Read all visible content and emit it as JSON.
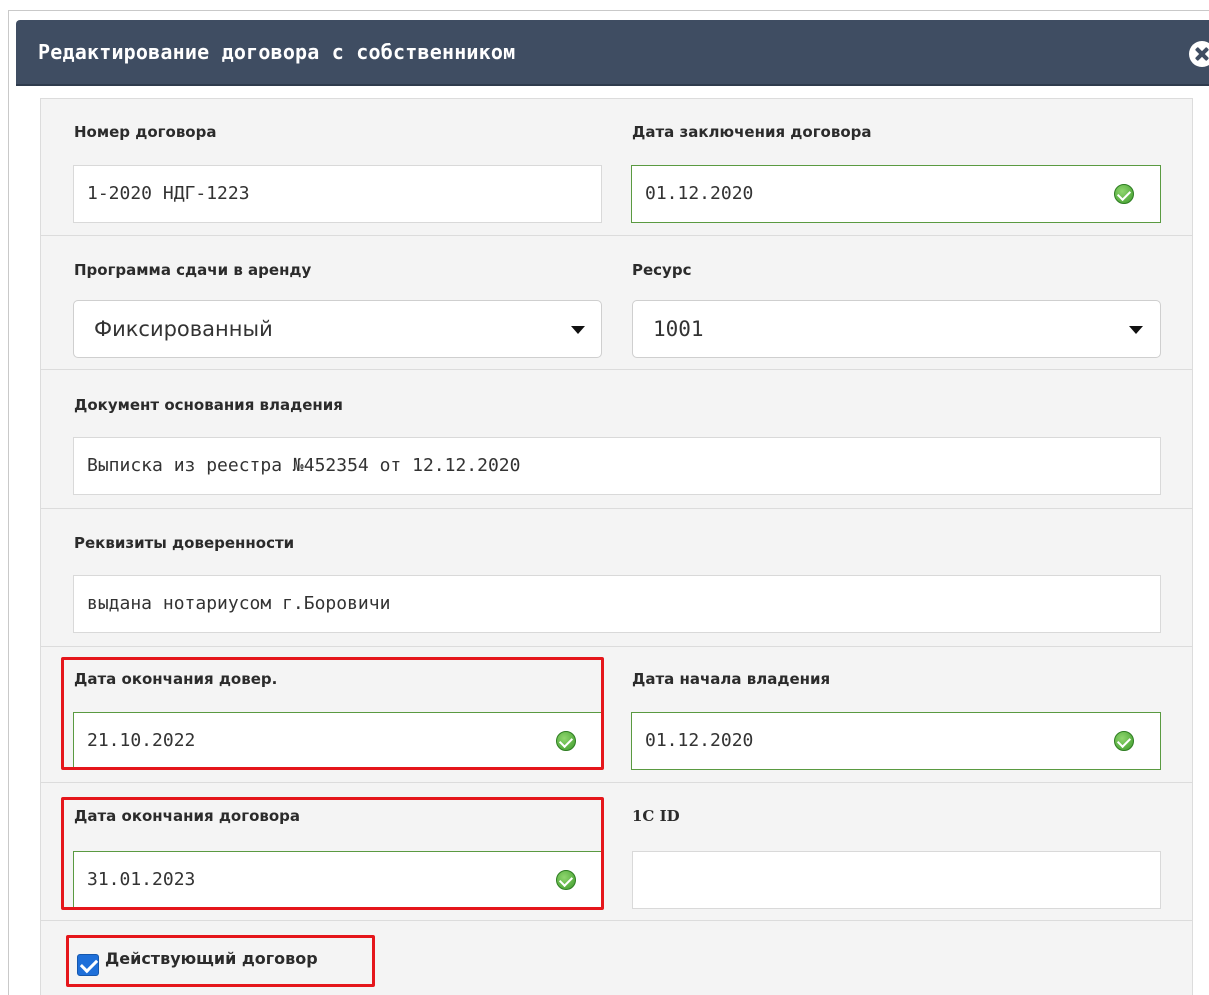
{
  "dialog": {
    "title": "Редактирование договора с собственником"
  },
  "fields": {
    "contract_number": {
      "label": "Номер договора",
      "value": "1-2020 НДГ-1223"
    },
    "contract_date": {
      "label": "Дата заключения договора",
      "value": "01.12.2020"
    },
    "rental_program": {
      "label": "Программа сдачи в аренду",
      "value": "Фиксированный"
    },
    "resource": {
      "label": "Ресурс",
      "value": "1001"
    },
    "ownership_doc": {
      "label": "Документ основания владения",
      "value": "Выписка из реестра №452354 от 12.12.2020"
    },
    "poa_details": {
      "label": "Реквизиты доверенности",
      "value": "выдана нотариусом г.Боровичи"
    },
    "poa_end_date": {
      "label": "Дата окончания довер.",
      "value": "21.10.2022"
    },
    "ownership_start": {
      "label": "Дата начала владения",
      "value": "01.12.2020"
    },
    "contract_end_date": {
      "label": "Дата окончания договора",
      "value": "31.01.2023"
    },
    "onec_id": {
      "label": "1C ID",
      "value": ""
    },
    "active_contract": {
      "label": "Действующий договор",
      "checked": true
    }
  },
  "colors": {
    "titlebar": "#3f4d62",
    "valid_border": "#5a9a41",
    "highlight": "#e5161b",
    "checkbox": "#1e6fd9"
  }
}
